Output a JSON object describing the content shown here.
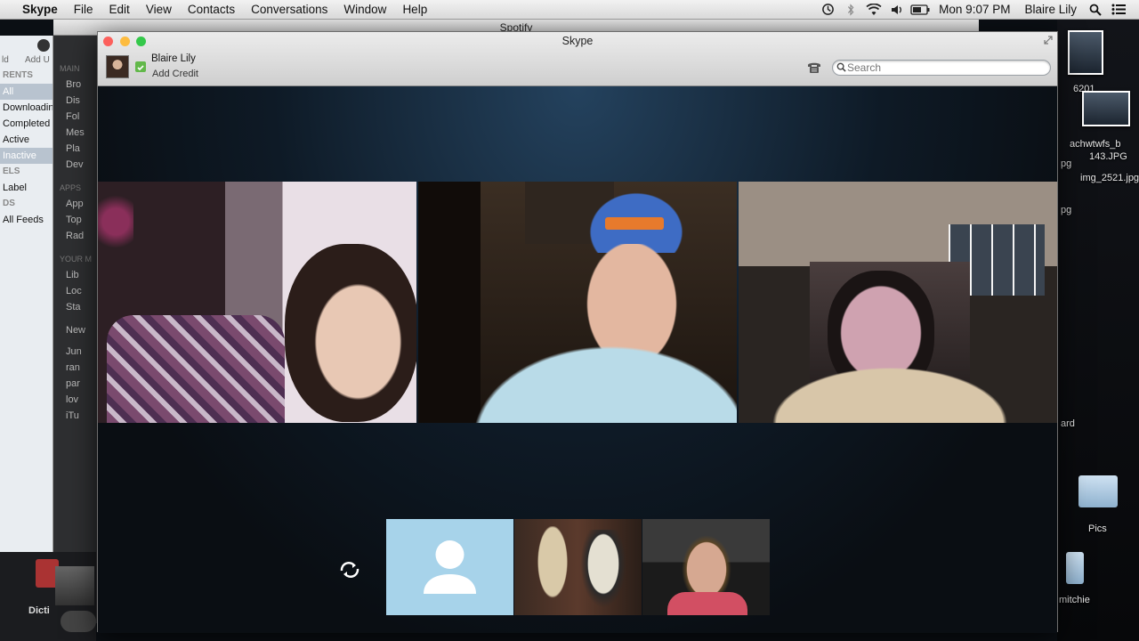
{
  "menubar": {
    "app_name": "Skype",
    "items": [
      "File",
      "Edit",
      "View",
      "Contacts",
      "Conversations",
      "Window",
      "Help"
    ],
    "clock": "Mon 9:07 PM",
    "user": "Blaire Lily",
    "status_icons": [
      "time-machine-icon",
      "bluetooth-icon",
      "wifi-icon",
      "volume-icon",
      "battery-icon"
    ]
  },
  "background_app": {
    "toolbar_labels": [
      "ld",
      "Add U"
    ],
    "rows": [
      {
        "text": "RENTS",
        "kind": "header"
      },
      {
        "text": "All",
        "kind": "selected"
      },
      {
        "text": "Downloading",
        "kind": "item"
      },
      {
        "text": "Completed",
        "kind": "item"
      },
      {
        "text": "Active",
        "kind": "item"
      },
      {
        "text": "Inactive",
        "kind": "selected"
      },
      {
        "text": "ELS",
        "kind": "header"
      },
      {
        "text": "Label",
        "kind": "item"
      },
      {
        "text": "DS",
        "kind": "header"
      },
      {
        "text": "All Feeds",
        "kind": "item"
      }
    ],
    "dock_label": "Dicti"
  },
  "spotify": {
    "title": "Spotify",
    "section_main": "MAIN",
    "main_items": [
      "Bro",
      "Dis",
      "Fol",
      "Mes",
      "Pla",
      "Dev"
    ],
    "section_apps": "APPS",
    "apps_items": [
      "App",
      "Top",
      "Rad"
    ],
    "section_your": "YOUR M",
    "your_items": [
      "Lib",
      "Loc",
      "Sta"
    ],
    "new_item": "New",
    "playlists": [
      "Jun",
      "ran",
      "par",
      "lov",
      "iTu"
    ]
  },
  "desktop": {
    "labels": [
      "6201",
      "achwtwfs_b",
      "pg",
      "143.JPG",
      "img_2521.jpg",
      "pg",
      "ard",
      "Pics",
      "mitchie"
    ]
  },
  "skype": {
    "title": "Skype",
    "username": "Blaire Lily",
    "add_credit": "Add Credit",
    "search_placeholder": "Search",
    "status_color": "#62b84a"
  },
  "call": {
    "main_participants": [
      "participant-1",
      "participant-2",
      "participant-3"
    ],
    "thumbnail_participants": [
      "no-video-contact",
      "participant-4",
      "participant-5"
    ]
  },
  "colors": {
    "traffic_close": "#fc605c",
    "traffic_min": "#fdbc40",
    "traffic_max": "#34c84a",
    "placeholder_tile": "#a7d3ea"
  }
}
